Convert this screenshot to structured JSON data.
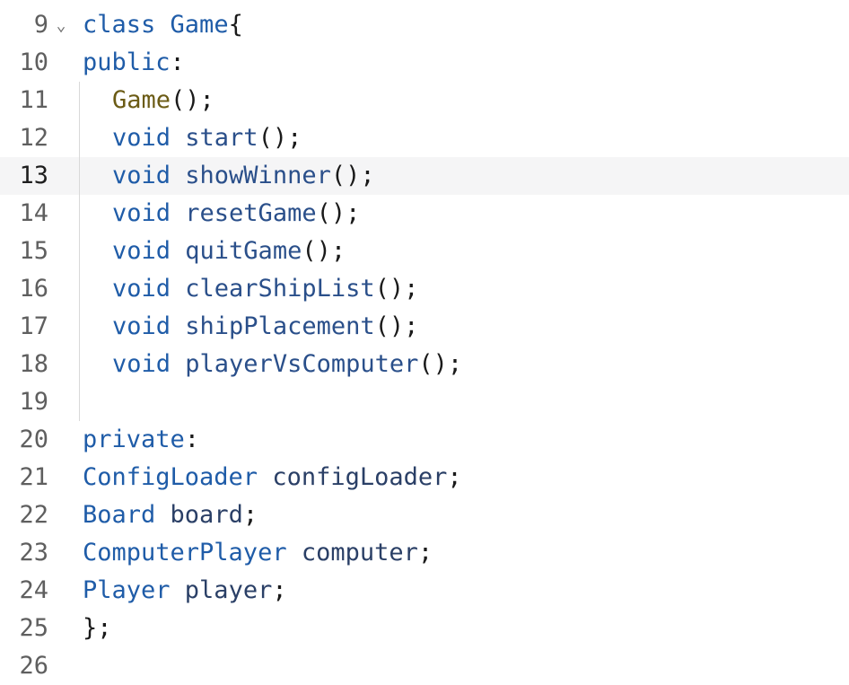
{
  "lines": [
    {
      "num": "9",
      "parts": [
        [
          "kw",
          "class "
        ],
        [
          "type",
          "Game"
        ],
        [
          "punct",
          "{"
        ]
      ]
    },
    {
      "num": "10",
      "parts": [
        [
          "kw",
          "public"
        ],
        [
          "punct",
          ":"
        ]
      ]
    },
    {
      "num": "11",
      "parts": [
        [
          "ctor",
          "Game"
        ],
        [
          "punct",
          "();"
        ]
      ]
    },
    {
      "num": "12",
      "parts": [
        [
          "kw",
          "void "
        ],
        [
          "fn",
          "start"
        ],
        [
          "punct",
          "();"
        ]
      ]
    },
    {
      "num": "13",
      "parts": [
        [
          "kw",
          "void "
        ],
        [
          "fn",
          "showWinner"
        ],
        [
          "punct",
          "();"
        ]
      ]
    },
    {
      "num": "14",
      "parts": [
        [
          "kw",
          "void "
        ],
        [
          "fn",
          "resetGame"
        ],
        [
          "punct",
          "();"
        ]
      ]
    },
    {
      "num": "15",
      "parts": [
        [
          "kw",
          "void "
        ],
        [
          "fn",
          "quitGame"
        ],
        [
          "punct",
          "();"
        ]
      ]
    },
    {
      "num": "16",
      "parts": [
        [
          "kw",
          "void "
        ],
        [
          "fn",
          "clearShipList"
        ],
        [
          "punct",
          "();"
        ]
      ]
    },
    {
      "num": "17",
      "parts": [
        [
          "kw",
          "void "
        ],
        [
          "fn",
          "shipPlacement"
        ],
        [
          "punct",
          "();"
        ]
      ]
    },
    {
      "num": "18",
      "parts": [
        [
          "kw",
          "void "
        ],
        [
          "fn",
          "playerVsComputer"
        ],
        [
          "punct",
          "();"
        ]
      ]
    },
    {
      "num": "19",
      "parts": []
    },
    {
      "num": "20",
      "parts": [
        [
          "kw",
          "private"
        ],
        [
          "punct",
          ":"
        ]
      ]
    },
    {
      "num": "21",
      "parts": [
        [
          "type",
          "ConfigLoader "
        ],
        [
          "ident",
          "configLoader"
        ],
        [
          "punct",
          ";"
        ]
      ]
    },
    {
      "num": "22",
      "parts": [
        [
          "type",
          "Board "
        ],
        [
          "ident",
          "board"
        ],
        [
          "punct",
          ";"
        ]
      ]
    },
    {
      "num": "23",
      "parts": [
        [
          "type",
          "ComputerPlayer "
        ],
        [
          "ident",
          "computer"
        ],
        [
          "punct",
          ";"
        ]
      ]
    },
    {
      "num": "24",
      "parts": [
        [
          "type",
          "Player "
        ],
        [
          "ident",
          "player"
        ],
        [
          "punct",
          ";"
        ]
      ]
    },
    {
      "num": "25",
      "parts": [
        [
          "punct",
          "};"
        ]
      ]
    },
    {
      "num": "26",
      "parts": []
    }
  ],
  "current_line": "13",
  "fold_glyph": "⌄",
  "fold_line": "9",
  "indented_lines": [
    "11",
    "12",
    "13",
    "14",
    "15",
    "16",
    "17",
    "18",
    "19"
  ]
}
